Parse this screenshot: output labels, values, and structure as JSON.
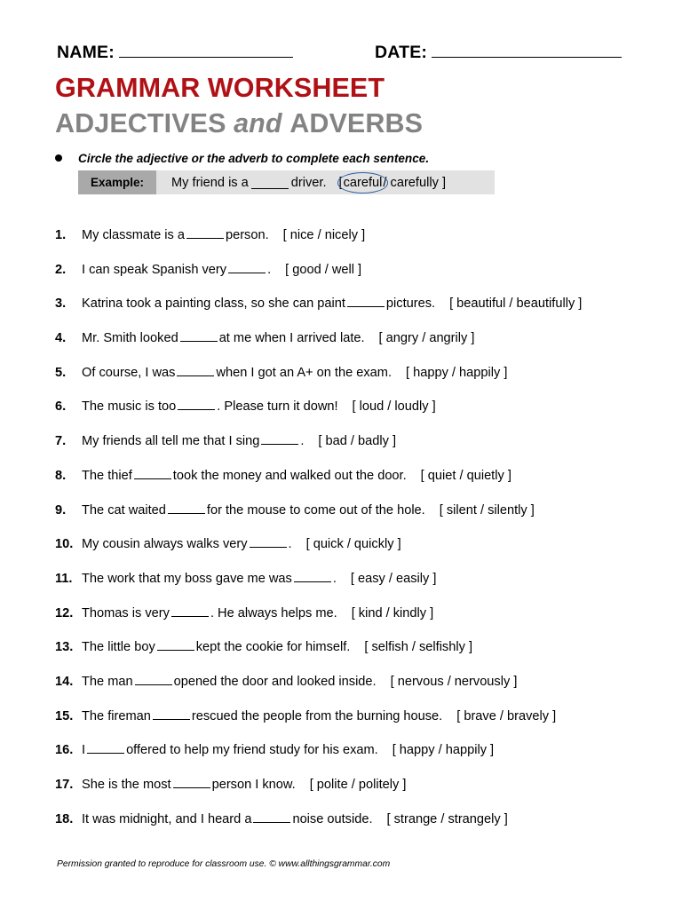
{
  "header": {
    "name_label": "NAME:",
    "date_label": "DATE:",
    "title": "GRAMMAR WORKSHEET",
    "subtitle_part1": "ADJECTIVES",
    "subtitle_conjunction": "and",
    "subtitle_part2": "ADVERBS",
    "title_color": "#b01116",
    "subtitle_color": "#838383"
  },
  "instruction": {
    "bullet": "bullet-icon",
    "text": "Circle the adjective or the adverb to complete each sentence."
  },
  "example": {
    "label": "Example:",
    "sentence_before": "My friend is a",
    "sentence_after": "driver.",
    "bracket_open": "[",
    "circled_choice": "careful",
    "separator": "/",
    "other_choice": "carefully",
    "bracket_close": "]",
    "circle_color": "#2b5fa8",
    "label_bg": "#a9a9a9",
    "body_bg": "#e2e2e2"
  },
  "questions": [
    {
      "number": "1.",
      "before": "My classmate is a",
      "after": "person.",
      "choices": "[ nice / nicely ]"
    },
    {
      "number": "2.",
      "before": "I can speak Spanish very",
      "after": ".",
      "choices": "[ good / well ]"
    },
    {
      "number": "3.",
      "before": "Katrina took a painting class, so she can paint",
      "after": "pictures.",
      "choices": "[ beautiful / beautifully ]"
    },
    {
      "number": "4.",
      "before": "Mr. Smith looked",
      "after": "at me when I arrived late.",
      "choices": "[ angry / angrily ]"
    },
    {
      "number": "5.",
      "before": "Of course, I was",
      "after": "when I got an A+ on the exam.",
      "choices": "[ happy / happily ]"
    },
    {
      "number": "6.",
      "before": "The music is too",
      "after": ".  Please turn it down!",
      "choices": "[ loud / loudly ]"
    },
    {
      "number": "7.",
      "before": "My friends all tell me that I sing",
      "after": ".",
      "choices": "[ bad / badly ]"
    },
    {
      "number": "8.",
      "before": "The thief",
      "after": "took the money and walked out the door.",
      "choices": "[ quiet / quietly ]"
    },
    {
      "number": "9.",
      "before": "The cat waited",
      "after": "for the mouse to come out of the hole.",
      "choices": "[ silent / silently ]"
    },
    {
      "number": "10.",
      "before": "My cousin always walks very",
      "after": ".",
      "choices": "[ quick / quickly ]"
    },
    {
      "number": "11.",
      "before": "The work that my boss gave me was",
      "after": ".",
      "choices": "[ easy / easily ]"
    },
    {
      "number": "12.",
      "before": "Thomas is very",
      "after": ".  He always helps me.",
      "choices": "[ kind / kindly ]"
    },
    {
      "number": "13.",
      "before": "The little boy",
      "after": "kept the cookie for himself.",
      "choices": "[ selfish / selfishly ]"
    },
    {
      "number": "14.",
      "before": "The man",
      "after": "opened the door and looked inside.",
      "choices": "[ nervous / nervously ]"
    },
    {
      "number": "15.",
      "before": "The fireman",
      "after": "rescued the people from the burning house.",
      "choices": "[ brave / bravely ]"
    },
    {
      "number": "16.",
      "before": "I",
      "after": "offered to help my friend study for his exam.",
      "choices": "[ happy / happily ]"
    },
    {
      "number": "17.",
      "before": "She is the most",
      "after": "person I know.",
      "choices": "[ polite / politely ]"
    },
    {
      "number": "18.",
      "before": "It was midnight, and I heard a",
      "after": "noise outside.",
      "choices": "[ strange / strangely ]"
    }
  ],
  "footer": {
    "text": "Permission granted to reproduce for classroom use.  © www.allthingsgrammar.com"
  }
}
